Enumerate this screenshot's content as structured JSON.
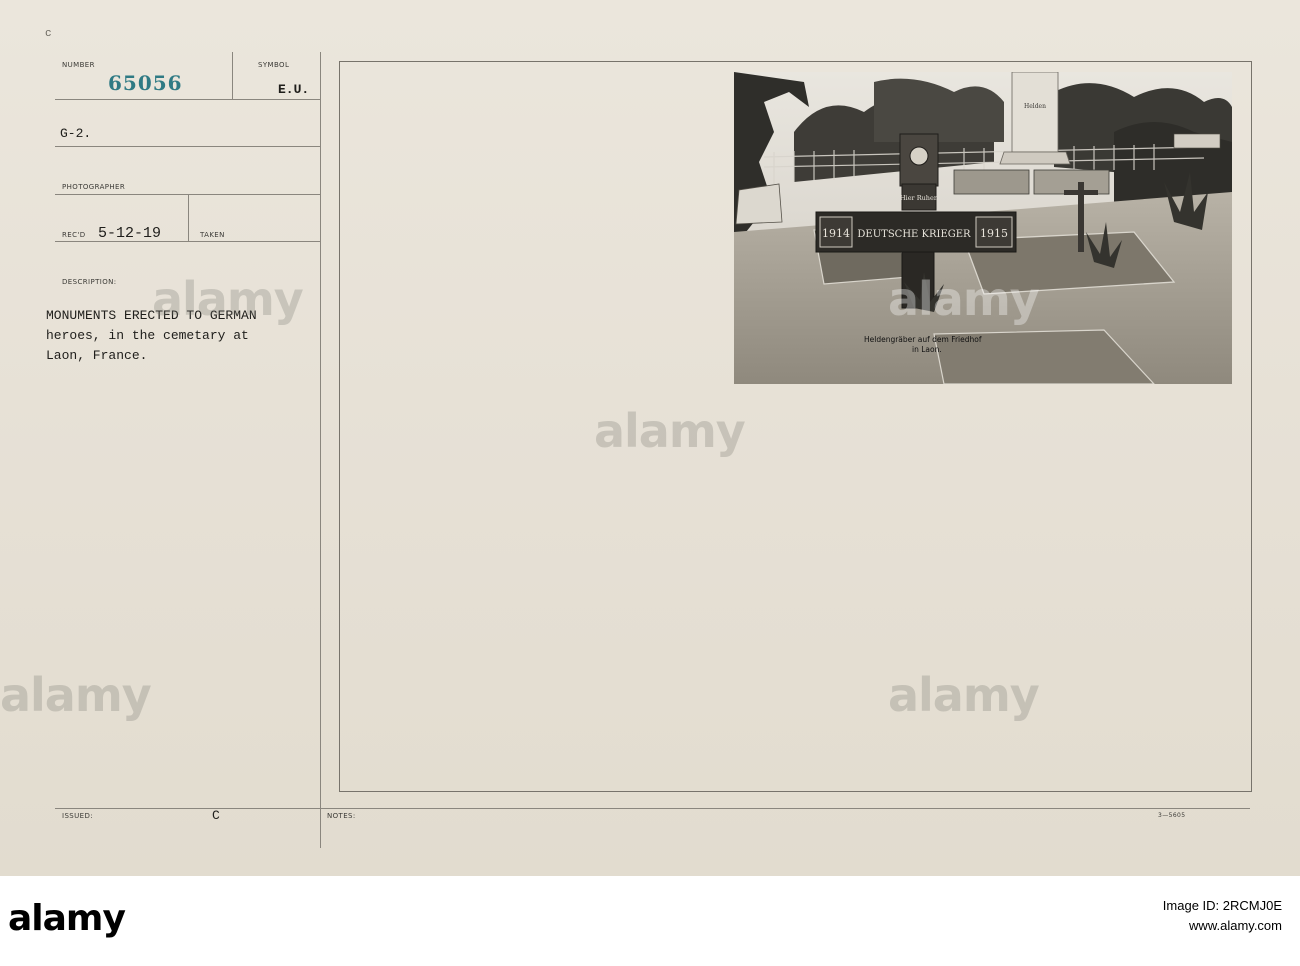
{
  "card": {
    "corner_mark": "c",
    "number_label": "NUMBER",
    "number_value": "65056",
    "symbol_label": "SYMBOL",
    "symbol_value": "E.U.",
    "source": "G-2.",
    "photographer_label": "PHOTOGRAPHER",
    "recd_label": "REC'D",
    "recd_value": "5-12-19",
    "taken_label": "TAKEN",
    "description_label": "DESCRIPTION:",
    "description_lines": [
      "MONUMENTS ERECTED TO GERMAN",
      "heroes, in the cemetary at",
      "Laon, France."
    ],
    "issued_label": "ISSUED:",
    "issued_value": "C",
    "notes_label": "NOTES:",
    "form_number": "3—5605"
  },
  "photo": {
    "caption_line1": "Heldengräber auf dem Friedhof",
    "caption_line2": "in Laon.",
    "cross_top": "Hier Ruhen",
    "cross_left_year": "1914",
    "cross_center": "DEUTSCHE KRIEGER",
    "cross_right_year": "1915",
    "obelisk_text": "Helden"
  },
  "watermark": {
    "text": "alamy"
  },
  "footer": {
    "logo": "alamy",
    "image_id_label": "Image ID: 2RCMJ0E",
    "site": "www.alamy.com"
  },
  "colors": {
    "card_bg": "#e7e1d6",
    "stamp_number": "#2f7a84",
    "typewriter": "#1f1e1b",
    "rule": "#8a867e"
  }
}
